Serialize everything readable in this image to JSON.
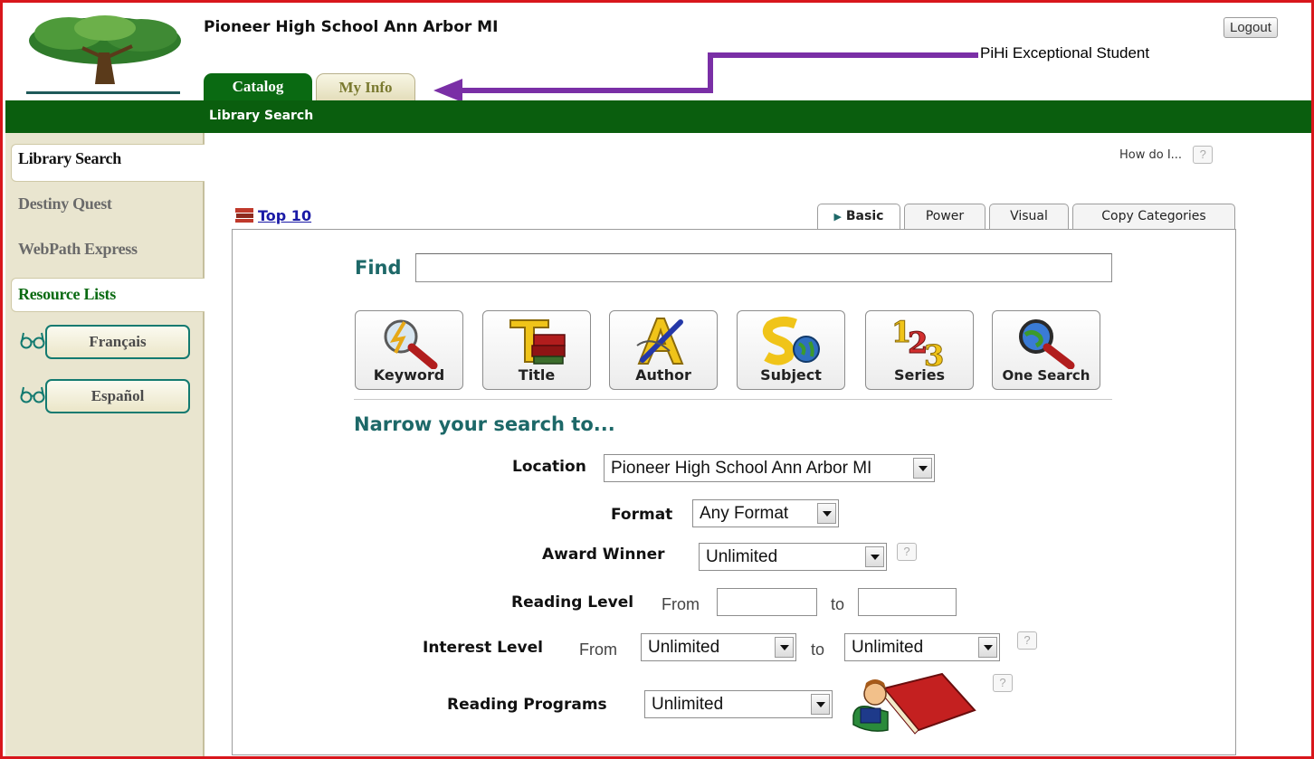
{
  "header": {
    "school_name": "Pioneer High School Ann Arbor MI",
    "logout_label": "Logout",
    "user_label": "PiHi  Exceptional Student",
    "tabs": [
      {
        "label": "Catalog"
      },
      {
        "label": "My Info"
      }
    ],
    "subnav_label": "Library Search"
  },
  "sidebar": {
    "items": [
      {
        "label": "Library Search"
      },
      {
        "label": "Destiny Quest"
      },
      {
        "label": "WebPath Express"
      },
      {
        "label": "Resource Lists"
      }
    ],
    "resource_lists": [
      {
        "label": "Français"
      },
      {
        "label": "Español"
      }
    ]
  },
  "main": {
    "how_do_i": "How do I...",
    "help_glyph": "?",
    "top10_label": "Top 10",
    "search_tabs": [
      {
        "label": "Basic"
      },
      {
        "label": "Power"
      },
      {
        "label": "Visual"
      },
      {
        "label": "Copy Categories"
      }
    ],
    "find_label": "Find",
    "find_value": "",
    "search_buttons": [
      {
        "label": "Keyword",
        "icon": "keyword-magnifier-icon"
      },
      {
        "label": "Title",
        "icon": "title-books-icon"
      },
      {
        "label": "Author",
        "icon": "author-pen-icon"
      },
      {
        "label": "Subject",
        "icon": "subject-globe-icon"
      },
      {
        "label": "Series",
        "icon": "series-123-icon"
      },
      {
        "label": "One Search",
        "icon": "one-search-magnifier-icon"
      }
    ],
    "narrow_heading": "Narrow your search to...",
    "filters": {
      "location_label": "Location",
      "location_value": "Pioneer High School Ann Arbor MI",
      "format_label": "Format",
      "format_value": "Any Format",
      "award_label": "Award Winner",
      "award_value": "Unlimited",
      "reading_level_label": "Reading Level",
      "reading_from_label": "From",
      "reading_to_label": "to",
      "reading_from_value": "",
      "reading_to_value": "",
      "interest_label": "Interest Level",
      "interest_from_label": "From",
      "interest_to_label": "to",
      "interest_from_value": "Unlimited",
      "interest_to_value": "Unlimited",
      "programs_label": "Reading Programs",
      "programs_value": "Unlimited"
    }
  },
  "colors": {
    "frame": "#d8161c",
    "green_bar": "#0a5e0e",
    "teal_heading": "#1d6868",
    "arrow": "#7a2fa6",
    "link": "#1a1aa6"
  }
}
